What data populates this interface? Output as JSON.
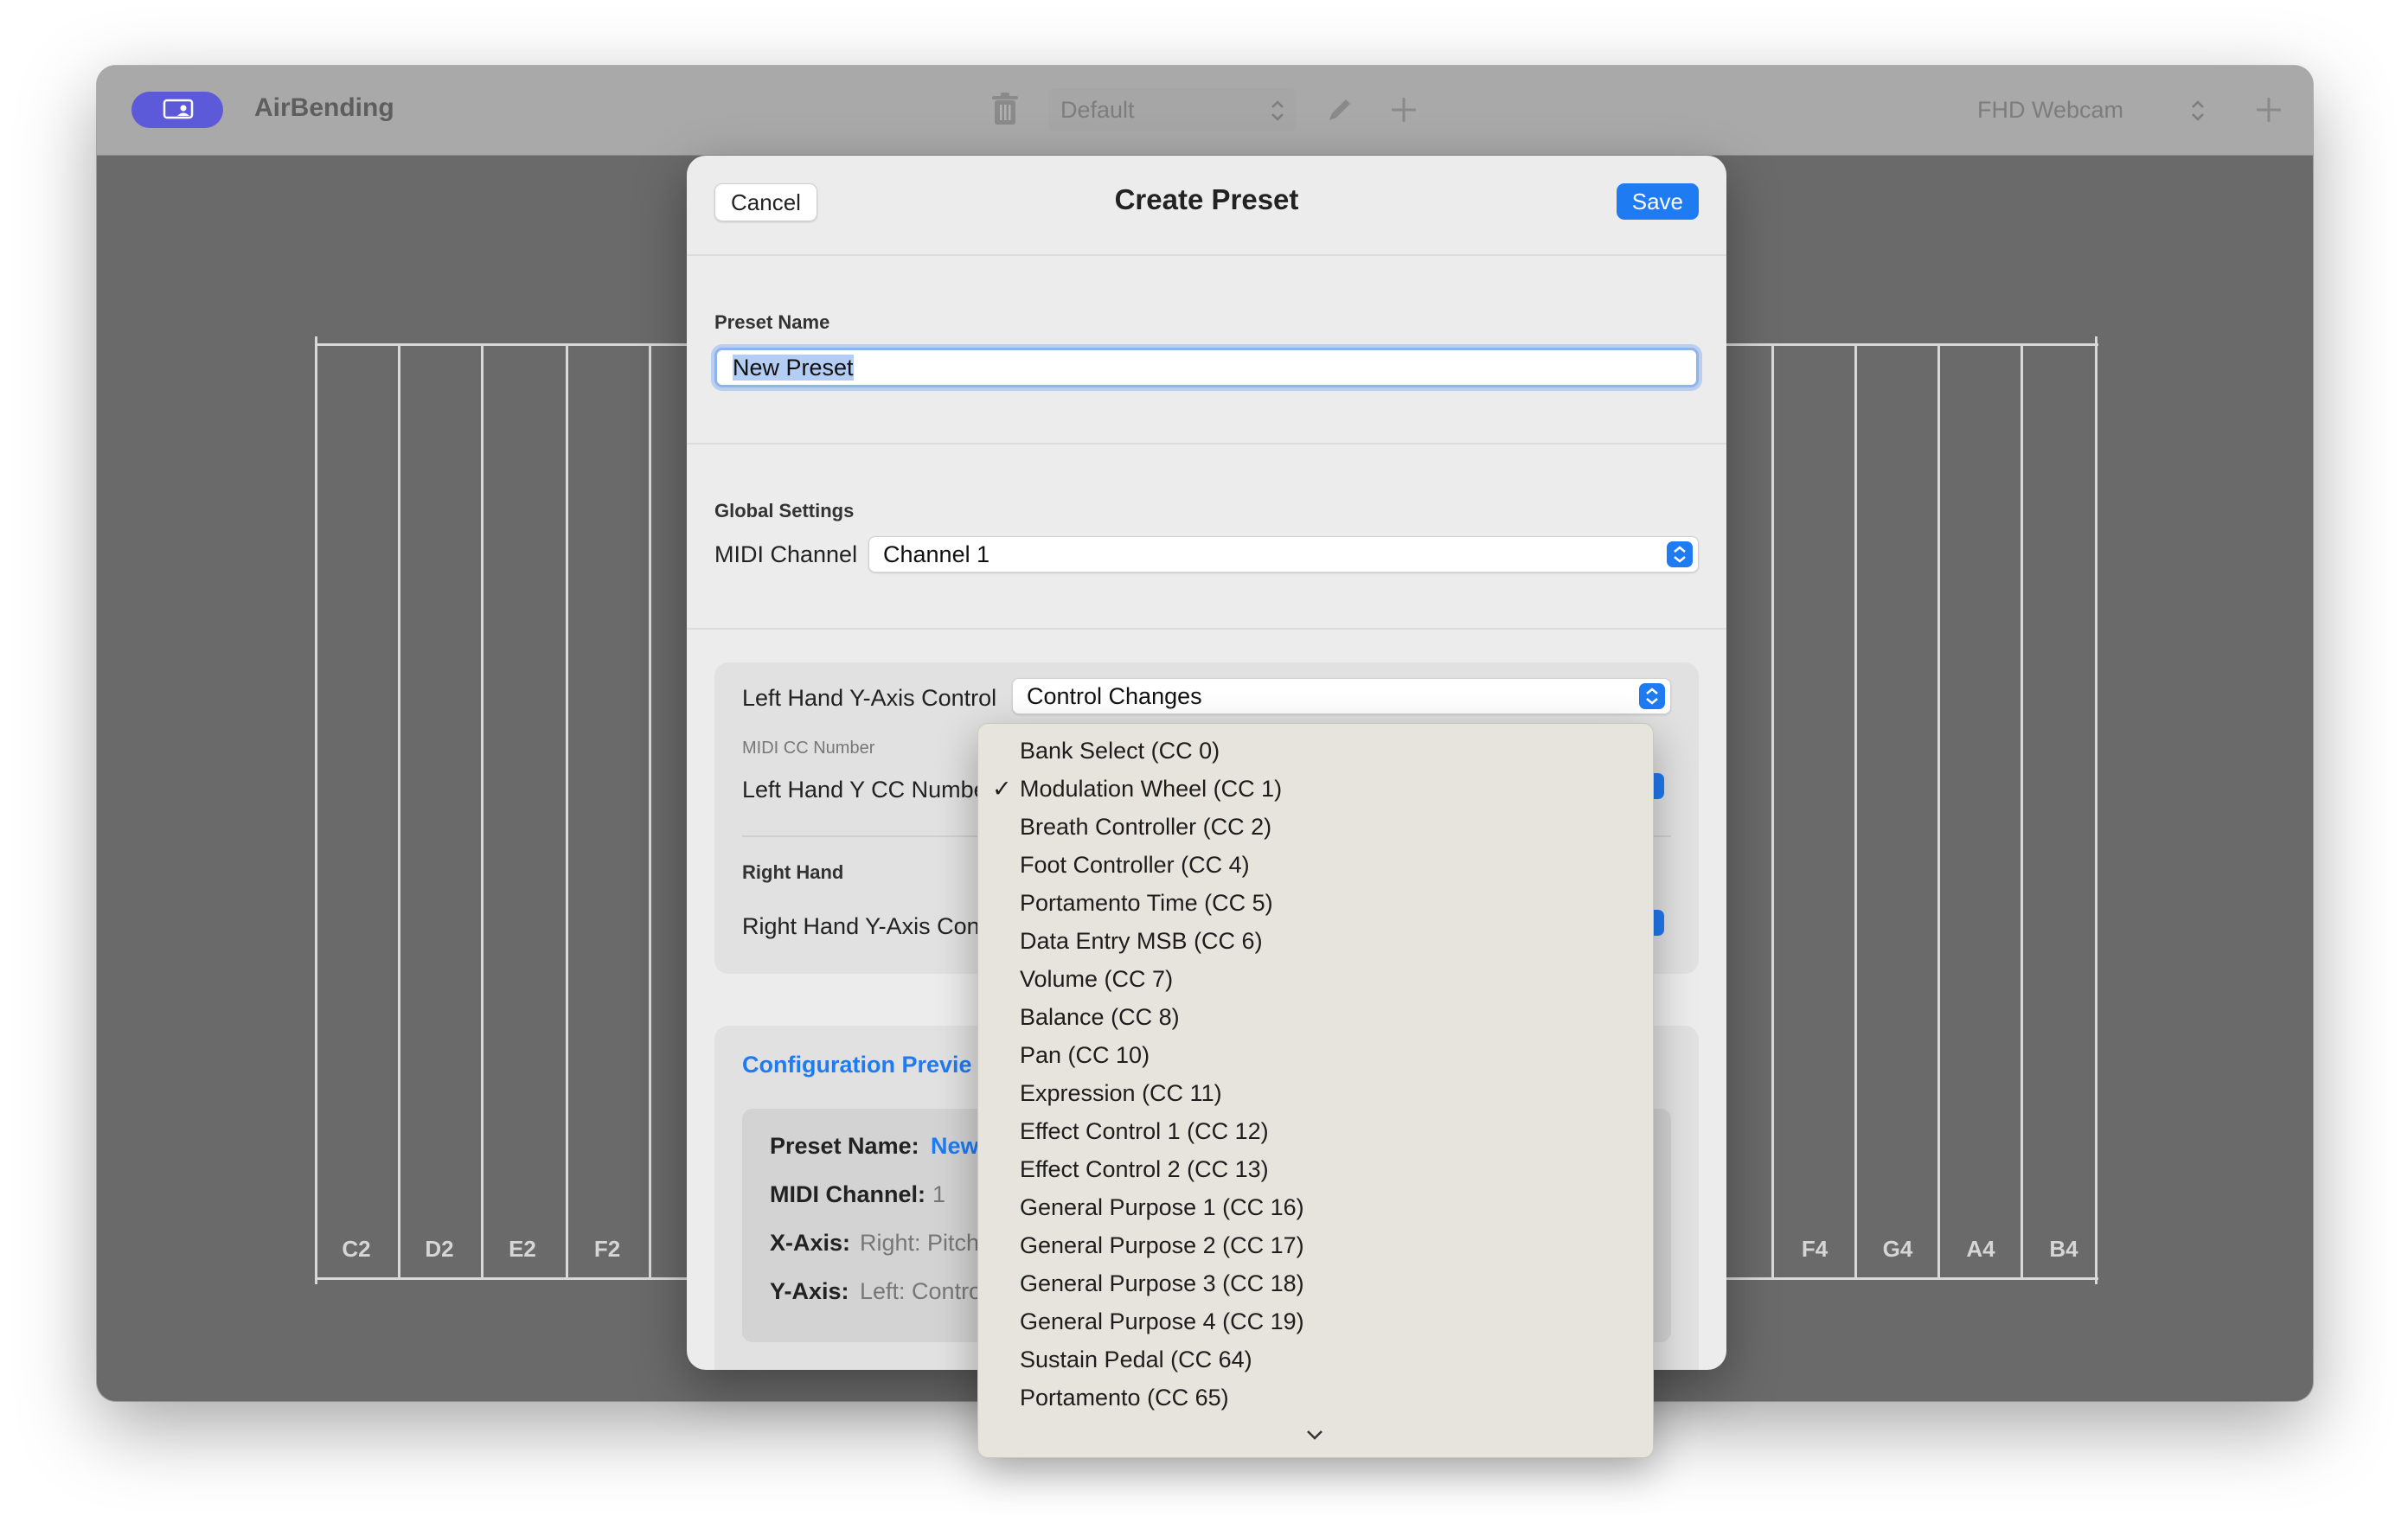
{
  "app": {
    "title": "AirBending"
  },
  "toolbar": {
    "preset_value": "Default",
    "camera_value": "FHD Webcam"
  },
  "keyboard": {
    "left_labels": [
      "C2",
      "D2",
      "E2",
      "F2"
    ],
    "right_labels": [
      "F4",
      "G4",
      "A4",
      "B4"
    ]
  },
  "modal": {
    "title": "Create Preset",
    "cancel_label": "Cancel",
    "save_label": "Save",
    "preset_name_label": "Preset Name",
    "preset_name_value": "New Preset",
    "global_settings_label": "Global Settings",
    "midi_channel_label": "MIDI Channel",
    "midi_channel_value": "Channel 1",
    "left_hand_y_label": "Left Hand Y-Axis Control",
    "left_hand_y_value": "Control Changes",
    "midi_cc_number_label": "MIDI CC Number",
    "left_hand_cc_label": "Left Hand Y CC Numbe",
    "right_hand_label": "Right Hand",
    "right_hand_y_label": "Right Hand Y-Axis Con",
    "preview": {
      "title": "Configuration Previe",
      "preset_name_key": "Preset Name:",
      "preset_name_val": "New",
      "midi_channel_key": "MIDI Channel:",
      "midi_channel_val": "1",
      "x_axis_key": "X-Axis:",
      "x_axis_val": "Right: Pitch",
      "y_axis_key": "Y-Axis:",
      "y_axis_val": "Left: Contro"
    }
  },
  "menu": {
    "selected_index": 1,
    "items": [
      "Bank Select (CC 0)",
      "Modulation Wheel (CC 1)",
      "Breath Controller (CC 2)",
      "Foot Controller (CC 4)",
      "Portamento Time (CC 5)",
      "Data Entry MSB (CC 6)",
      "Volume (CC 7)",
      "Balance (CC 8)",
      "Pan (CC 10)",
      "Expression (CC 11)",
      "Effect Control 1 (CC 12)",
      "Effect Control 2 (CC 13)",
      "General Purpose 1 (CC 16)",
      "General Purpose 2 (CC 17)",
      "General Purpose 3 (CC 18)",
      "General Purpose 4 (CC 19)",
      "Sustain Pedal (CC 64)",
      "Portamento (CC 65)"
    ]
  }
}
